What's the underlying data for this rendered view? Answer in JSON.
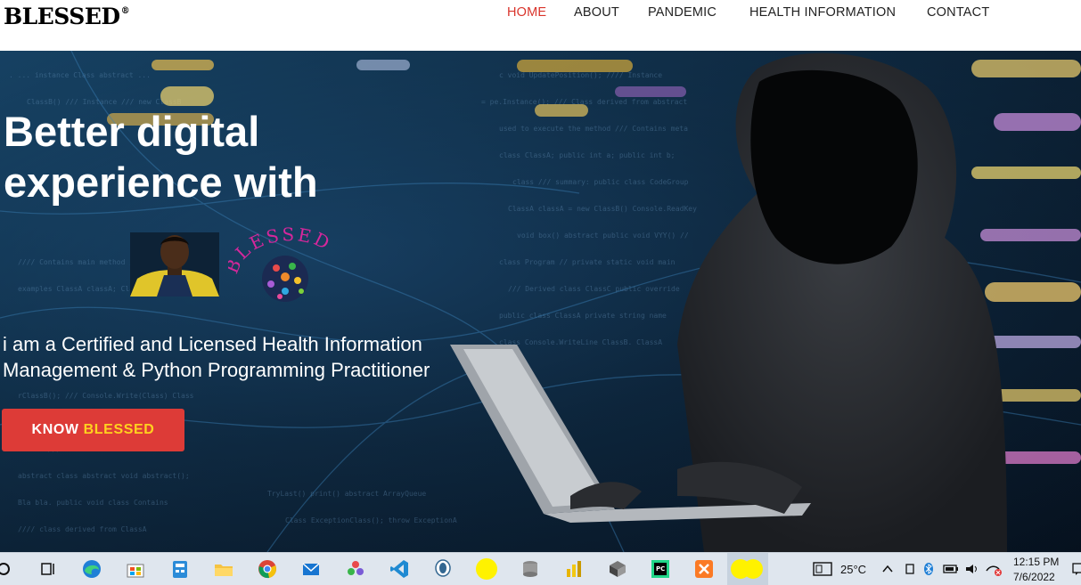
{
  "header": {
    "logo": "BLESSED",
    "logo_mark": "®",
    "nav": [
      "HOME",
      "ABOUT",
      "PANDEMIC",
      "HEALTH INFORMATION",
      "CONTACT"
    ],
    "active_nav": "HOME"
  },
  "hero": {
    "title_line1": "Better digital",
    "title_line2": "experience with",
    "brand_logo_text": "BLESSED",
    "subtitle_line1": "i am a Certified and Licensed Health Information",
    "subtitle_line2": "Management & Python Programming Practitioner",
    "button_prefix": "KNOW",
    "button_highlight": "BLESSED"
  },
  "colors": {
    "accent_red": "#dd3b37",
    "nav_active": "#d9342b",
    "button_highlight": "#ffd21f",
    "brand_pink": "#d6279c"
  },
  "taskbar": {
    "apps": [
      "search-icon",
      "task-view-icon",
      "edge-icon",
      "store-icon",
      "calculator-icon",
      "file-explorer-icon",
      "chrome-icon",
      "mail-icon",
      "photos-icon",
      "vscode-icon",
      "postgresql-icon",
      "yellow-app-icon",
      "database-icon",
      "power-bi-icon",
      "virtualbox-icon",
      "pycharm-icon",
      "xampp-icon",
      "yellow-app-active-icon"
    ],
    "temperature": "25°C",
    "time": "12:15 PM",
    "date": "7/6/2022"
  }
}
